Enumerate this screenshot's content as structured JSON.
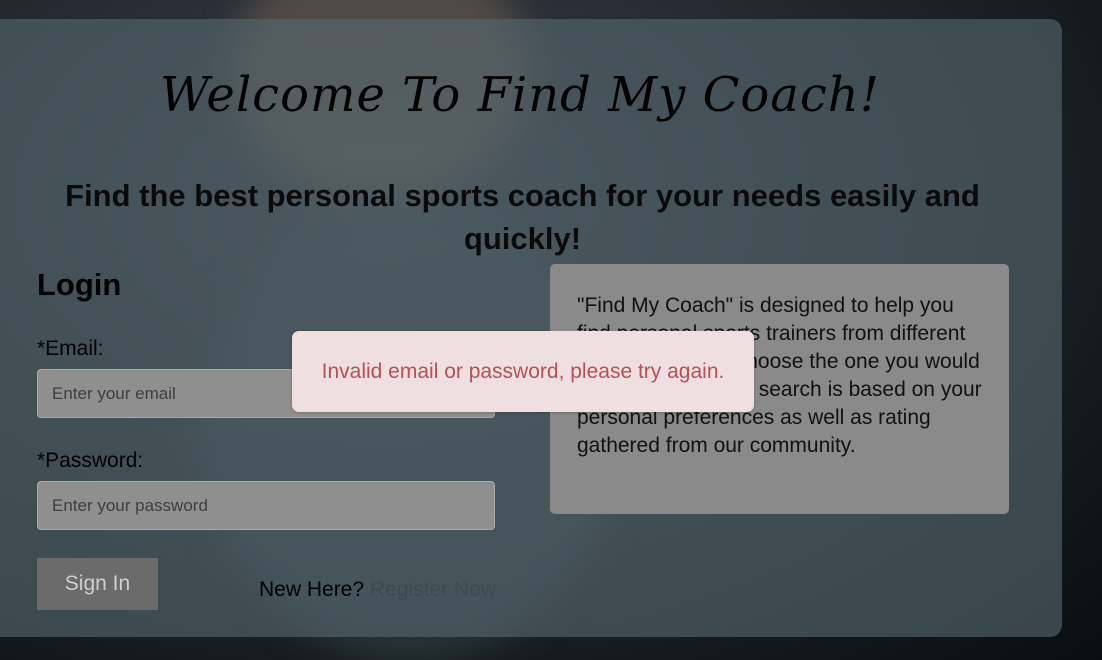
{
  "header": {
    "title": "Welcome To Find My Coach!",
    "subtitle": "Find the best personal sports coach for your needs easily and quickly!"
  },
  "login": {
    "heading": "Login",
    "email_label": "*Email:",
    "email_placeholder": "Enter your email",
    "password_label": "*Password:",
    "password_placeholder": "Enter your password",
    "signin_label": "Sign In",
    "new_here_text": "New Here?",
    "register_link": "Register Now"
  },
  "info": {
    "text": "\"Find My Coach\" is designed to help you find personal sports trainers from different sports fields and choose the one you would like to contact. The search is based on your personal preferences as well as rating gathered from our community."
  },
  "alert": {
    "message": "Invalid email or password, please try again."
  }
}
